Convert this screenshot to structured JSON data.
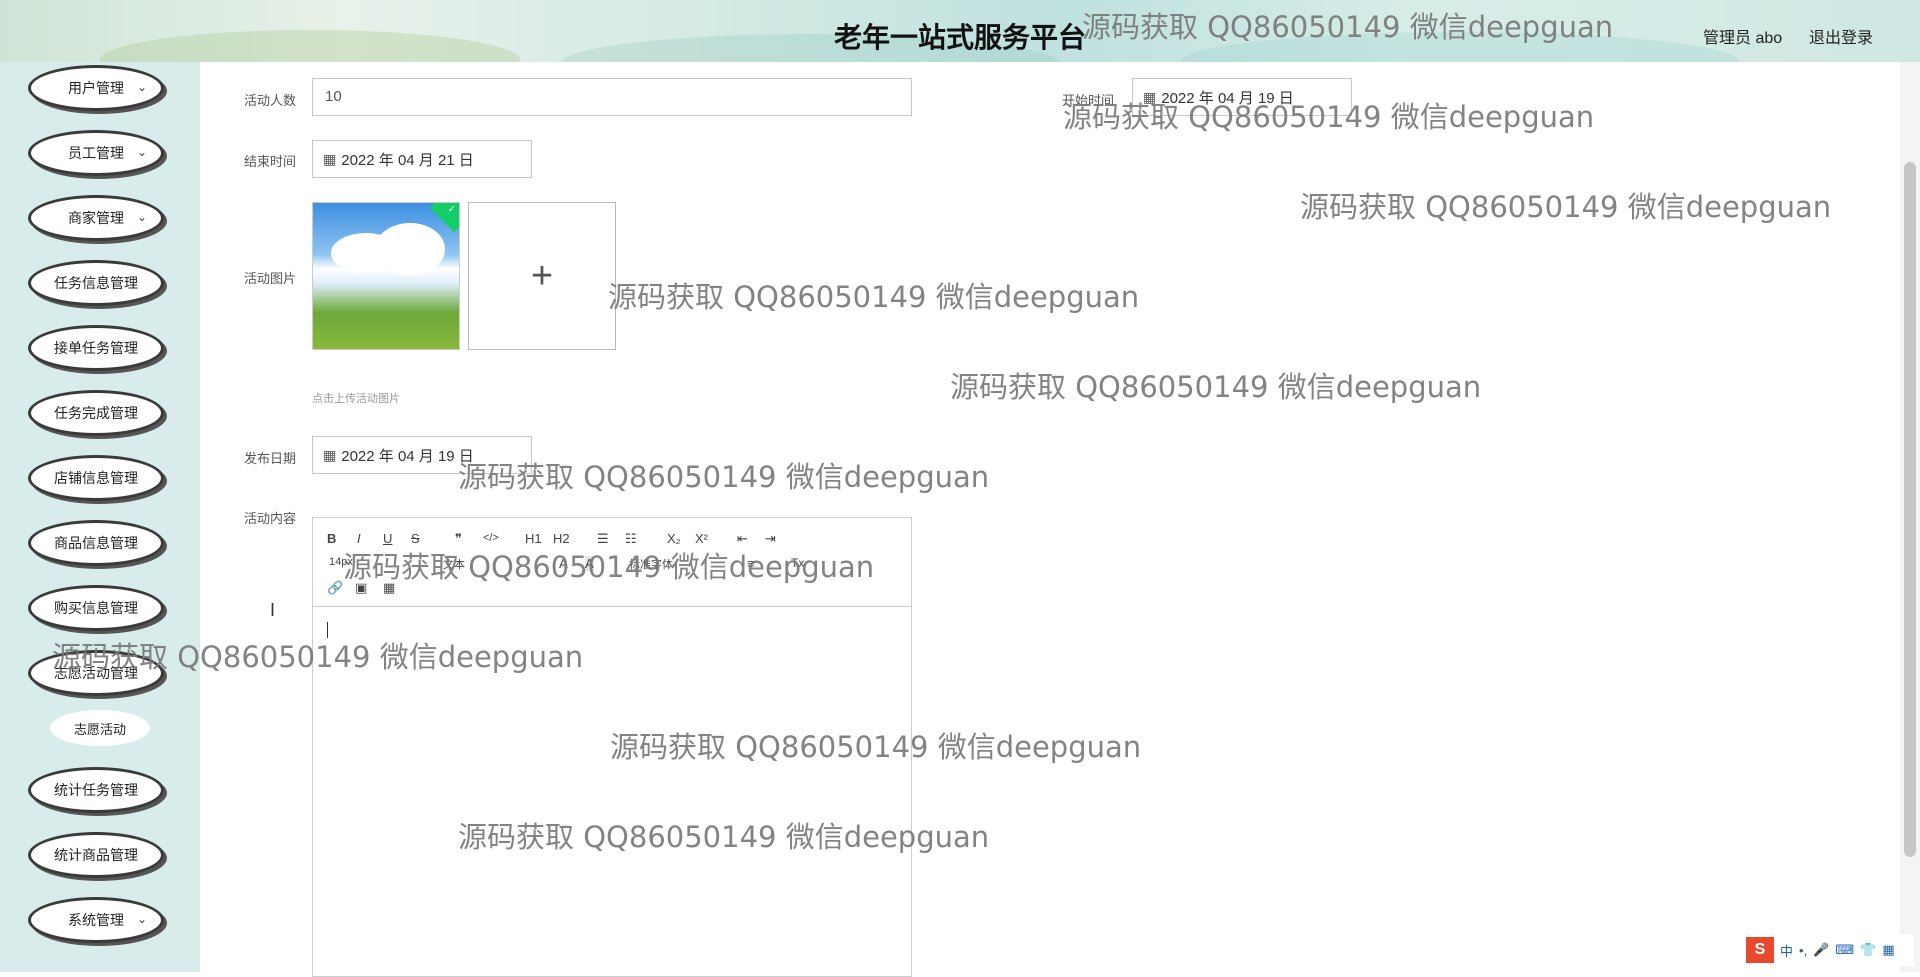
{
  "header": {
    "title": "老年一站式服务平台",
    "user_label": "管理员 abo",
    "logout_label": "退出登录"
  },
  "sidebar": {
    "items": [
      {
        "label": "用户管理",
        "has_chevron": true
      },
      {
        "label": "员工管理",
        "has_chevron": true
      },
      {
        "label": "商家管理",
        "has_chevron": true
      },
      {
        "label": "任务信息管理",
        "has_chevron": false
      },
      {
        "label": "接单任务管理",
        "has_chevron": false
      },
      {
        "label": "任务完成管理",
        "has_chevron": false
      },
      {
        "label": "店铺信息管理",
        "has_chevron": false
      },
      {
        "label": "商品信息管理",
        "has_chevron": false
      },
      {
        "label": "购买信息管理",
        "has_chevron": false
      },
      {
        "label": "志愿活动管理",
        "has_chevron": false
      },
      {
        "label": "统计任务管理",
        "has_chevron": false
      },
      {
        "label": "统计商品管理",
        "has_chevron": false
      },
      {
        "label": "系统管理",
        "has_chevron": true
      }
    ],
    "subitem": {
      "label": "志愿活动"
    },
    "chevron": "⌄"
  },
  "form": {
    "participants": {
      "label": "活动人数",
      "value": "10"
    },
    "start_time": {
      "label": "开始时间",
      "value": "2022 年 04 月 19 日"
    },
    "end_time": {
      "label": "结束时间",
      "value": "2022 年 04 月 21 日"
    },
    "image": {
      "label": "活动图片",
      "upload_symbol": "+",
      "hint": "点击上传活动图片"
    },
    "publish_date": {
      "label": "发布日期",
      "value": "2022 年 04 月 19 日"
    },
    "content": {
      "label": "活动内容"
    }
  },
  "editor_toolbar": {
    "row1": [
      "B",
      "I",
      "U",
      "S",
      "❞",
      "</>",
      "H1",
      "H2",
      "☰",
      "☷",
      "X₂",
      "X²",
      "⇤",
      "⇥"
    ],
    "row2": [
      "14px",
      "文本",
      "A",
      "A",
      "标准字体",
      "≡",
      "Tx"
    ],
    "row3": [
      "🔗",
      "▣",
      "▦"
    ]
  },
  "ime": {
    "logo": "S",
    "items": [
      "中",
      "•,",
      "🎤",
      "⌨",
      "👕",
      "▦"
    ]
  },
  "watermark": "源码获取 QQ86050149 微信deepguan",
  "colors": {
    "sidebar_bg": "#d9ecec",
    "success_badge": "#13ce66"
  }
}
